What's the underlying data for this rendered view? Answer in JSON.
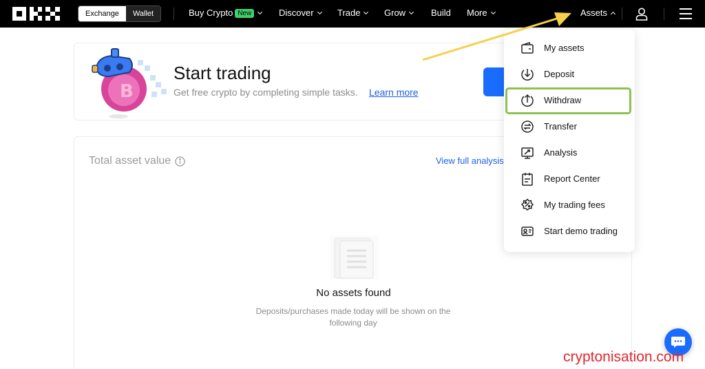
{
  "nav": {
    "logo": "OKX",
    "toggle": {
      "exchange": "Exchange",
      "wallet": "Wallet"
    },
    "items": {
      "buy_crypto": "Buy Crypto",
      "buy_badge": "New",
      "discover": "Discover",
      "trade": "Trade",
      "grow": "Grow",
      "build": "Build",
      "more": "More",
      "assets": "Assets"
    }
  },
  "banner": {
    "title": "Start trading",
    "subtitle": "Get free crypto by completing simple tasks.",
    "link": "Learn more"
  },
  "assets": {
    "total_label": "Total asset value",
    "view_link": "View full analysis",
    "empty_title": "No assets found",
    "empty_sub": "Deposits/purchases made today will be shown on the following day"
  },
  "dropdown": {
    "items": [
      {
        "label": "My assets",
        "icon": "wallet-icon"
      },
      {
        "label": "Deposit",
        "icon": "deposit-icon"
      },
      {
        "label": "Withdraw",
        "icon": "withdraw-icon",
        "highlighted": true
      },
      {
        "label": "Transfer",
        "icon": "transfer-icon"
      },
      {
        "label": "Analysis",
        "icon": "analysis-icon"
      },
      {
        "label": "Report Center",
        "icon": "report-icon"
      },
      {
        "label": "My trading fees",
        "icon": "fees-icon"
      },
      {
        "label": "Start demo trading",
        "icon": "demo-icon"
      }
    ]
  },
  "colors": {
    "accent": "#1a6cff",
    "highlight": "#8cc152",
    "annotation_arrow": "#f5d04c",
    "watermark": "#e0282f"
  },
  "watermark": "cryptonisation.com"
}
